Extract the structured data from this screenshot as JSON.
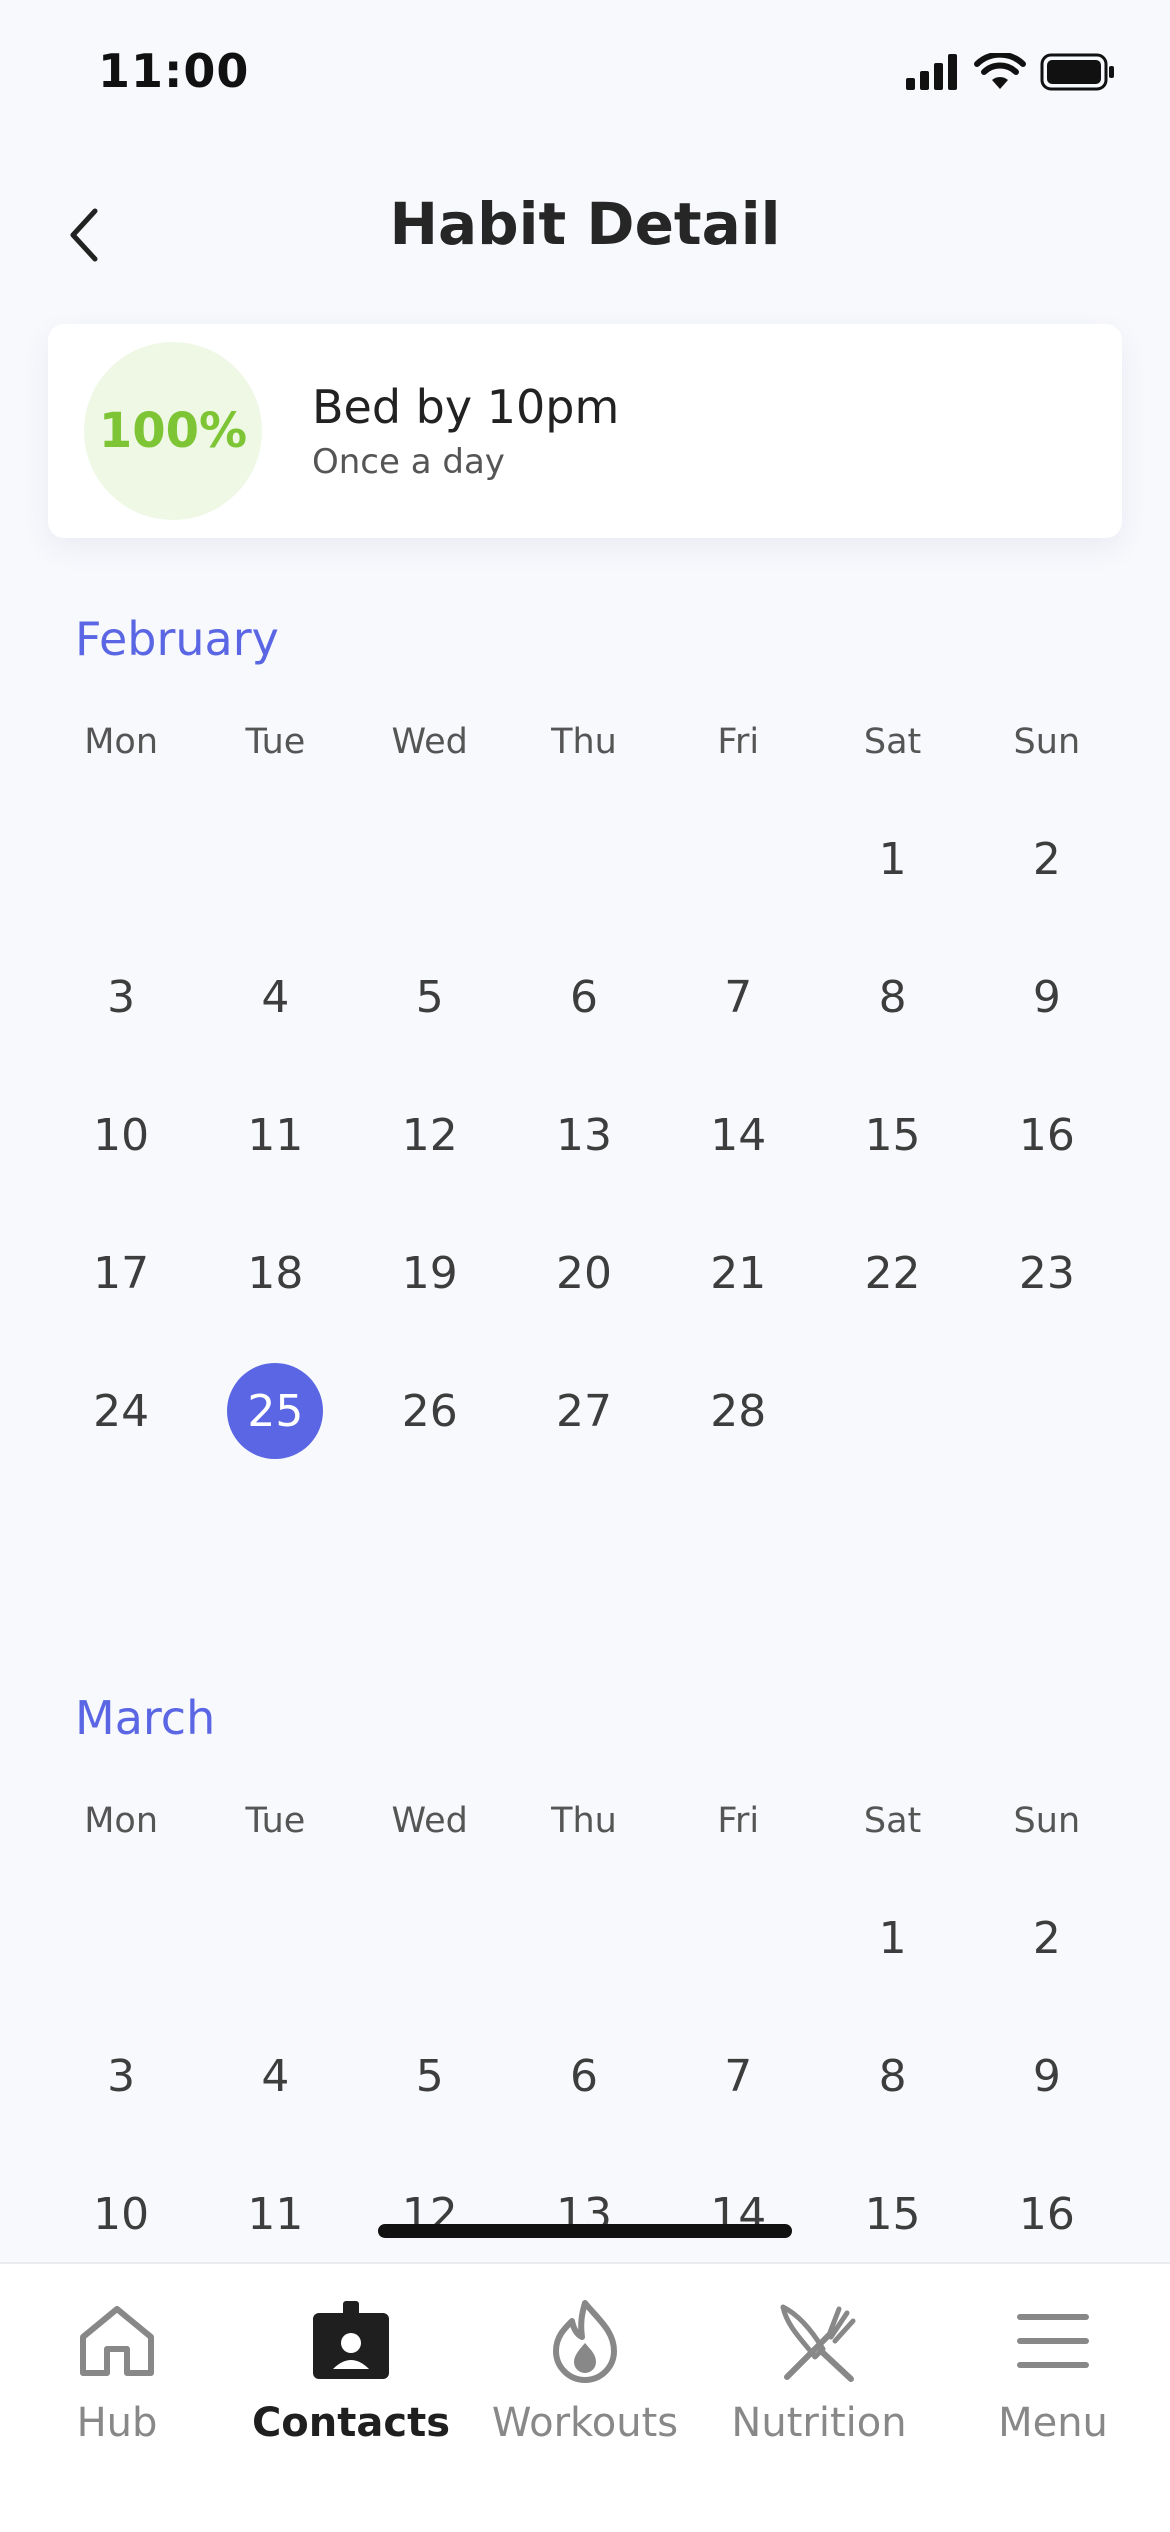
{
  "status_bar": {
    "time": "11:00",
    "icons": [
      "signal-icon",
      "wifi-icon",
      "battery-icon"
    ]
  },
  "header": {
    "title": "Habit Detail",
    "back_icon": "chevron-left-icon"
  },
  "habit": {
    "progress": "100%",
    "name": "Bed by 10pm",
    "frequency": "Once a day"
  },
  "colors": {
    "accent": "#5a66e3",
    "progress_green": "#7ec535",
    "progress_bg": "#eef8e5"
  },
  "weekdays": [
    "Mon",
    "Tue",
    "Wed",
    "Thu",
    "Fri",
    "Sat",
    "Sun"
  ],
  "months": [
    {
      "name": "February",
      "days": [
        "",
        "",
        "",
        "",
        "",
        "1",
        "2",
        "3",
        "4",
        "5",
        "6",
        "7",
        "8",
        "9",
        "10",
        "11",
        "12",
        "13",
        "14",
        "15",
        "16",
        "17",
        "18",
        "19",
        "20",
        "21",
        "22",
        "23",
        "24",
        "25",
        "26",
        "27",
        "28",
        "",
        ""
      ],
      "selected": "25"
    },
    {
      "name": "March",
      "days": [
        "",
        "",
        "",
        "",
        "",
        "1",
        "2",
        "3",
        "4",
        "5",
        "6",
        "7",
        "8",
        "9",
        "10",
        "11",
        "12",
        "13",
        "14",
        "15",
        "16"
      ],
      "selected": ""
    }
  ],
  "tab_bar": {
    "active": "Contacts",
    "tabs": [
      {
        "label": "Hub",
        "icon": "home-icon"
      },
      {
        "label": "Contacts",
        "icon": "contact-badge-icon"
      },
      {
        "label": "Workouts",
        "icon": "flame-icon"
      },
      {
        "label": "Nutrition",
        "icon": "fork-knife-icon"
      },
      {
        "label": "Menu",
        "icon": "hamburger-menu-icon"
      }
    ]
  }
}
